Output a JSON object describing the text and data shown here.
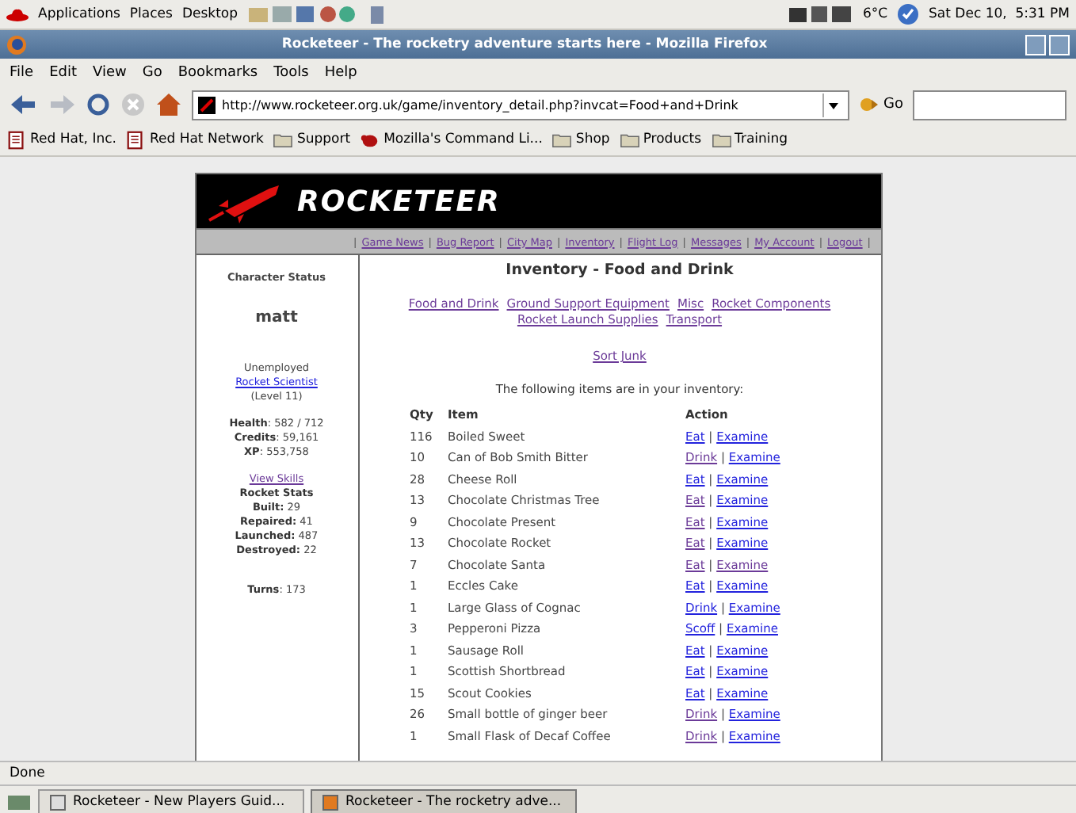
{
  "top_panel": {
    "menus": [
      "Applications",
      "Places",
      "Desktop"
    ],
    "temperature": "6°C",
    "clock": "Sat Dec 10,  5:31 PM"
  },
  "window": {
    "title": "Rocketeer - The rocketry adventure starts here - Mozilla Firefox"
  },
  "menu_bar": [
    "File",
    "Edit",
    "View",
    "Go",
    "Bookmarks",
    "Tools",
    "Help"
  ],
  "address_bar": {
    "url": "http://www.rocketeer.org.uk/game/inventory_detail.php?invcat=Food+and+Drink",
    "go": "Go"
  },
  "bookmarks": [
    {
      "kind": "page",
      "label": "Red Hat, Inc."
    },
    {
      "kind": "page",
      "label": "Red Hat Network"
    },
    {
      "kind": "folder",
      "label": "Support"
    },
    {
      "kind": "bug",
      "label": "Mozilla's Command Li..."
    },
    {
      "kind": "folder",
      "label": "Shop"
    },
    {
      "kind": "folder",
      "label": "Products"
    },
    {
      "kind": "folder",
      "label": "Training"
    }
  ],
  "site": {
    "logo": "ROCKETEER",
    "nav_separator": "|",
    "nav": [
      {
        "label": "Game News",
        "visited": true
      },
      {
        "label": "Bug Report",
        "visited": true
      },
      {
        "label": "City Map",
        "visited": true
      },
      {
        "label": "Inventory",
        "visited": true
      },
      {
        "label": "Flight Log",
        "visited": true
      },
      {
        "label": "Messages",
        "visited": true
      },
      {
        "label": "My Account",
        "visited": true
      },
      {
        "label": "Logout",
        "visited": true
      }
    ],
    "sidebar": {
      "heading": "Character Status",
      "name": "matt",
      "job": "Unemployed",
      "job_link": {
        "label": "Rocket Scientist",
        "visited": false
      },
      "level": "(Level 11)",
      "stats": [
        "**Health**: 582 / 712",
        "**Credits**: 59,161",
        "**XP**: 553,758"
      ],
      "skills_link": {
        "label": "View Skills",
        "visited": true
      },
      "rocket_stats_heading": "Rocket Stats",
      "rocket_stats": [
        "**Built:** 29",
        "**Repaired:** 41",
        "**Launched:** 487",
        "**Destroyed:** 22"
      ],
      "turns": "**Turns**: 173"
    },
    "main": {
      "heading": "Inventory - Food and Drink",
      "categories": [
        {
          "label": "Food and Drink",
          "visited": true
        },
        {
          "label": "Ground Support Equipment",
          "visited": true
        },
        {
          "label": "Misc",
          "visited": true
        },
        {
          "label": "Rocket Components",
          "visited": true
        },
        {
          "label": "Rocket Launch Supplies",
          "visited": true
        },
        {
          "label": "Transport",
          "visited": true
        }
      ],
      "sort_link": {
        "label": "Sort Junk",
        "visited": true
      },
      "intro": "The following items are in your inventory:",
      "columns": [
        "Qty",
        "Item",
        "Action"
      ],
      "action_separator": "|",
      "rows": [
        {
          "qty": "116",
          "item": "Boiled Sweet",
          "actions": [
            {
              "label": "Eat",
              "visited": false
            },
            {
              "label": "Examine",
              "visited": false
            }
          ]
        },
        {
          "qty": "10",
          "item": "Can of Bob Smith Bitter",
          "actions": [
            {
              "label": "Drink",
              "visited": true
            },
            {
              "label": "Examine",
              "visited": false
            }
          ]
        },
        {
          "qty": "28",
          "item": "Cheese Roll",
          "actions": [
            {
              "label": "Eat",
              "visited": false
            },
            {
              "label": "Examine",
              "visited": false
            }
          ]
        },
        {
          "qty": "13",
          "item": "Chocolate Christmas Tree",
          "actions": [
            {
              "label": "Eat",
              "visited": true
            },
            {
              "label": "Examine",
              "visited": false
            }
          ]
        },
        {
          "qty": "9",
          "item": "Chocolate Present",
          "actions": [
            {
              "label": "Eat",
              "visited": true
            },
            {
              "label": "Examine",
              "visited": false
            }
          ]
        },
        {
          "qty": "13",
          "item": "Chocolate Rocket",
          "actions": [
            {
              "label": "Eat",
              "visited": true
            },
            {
              "label": "Examine",
              "visited": false
            }
          ]
        },
        {
          "qty": "7",
          "item": "Chocolate Santa",
          "actions": [
            {
              "label": "Eat",
              "visited": true
            },
            {
              "label": "Examine",
              "visited": true
            }
          ]
        },
        {
          "qty": "1",
          "item": "Eccles Cake",
          "actions": [
            {
              "label": "Eat",
              "visited": false
            },
            {
              "label": "Examine",
              "visited": false
            }
          ]
        },
        {
          "qty": "1",
          "item": "Large Glass of Cognac",
          "actions": [
            {
              "label": "Drink",
              "visited": false
            },
            {
              "label": "Examine",
              "visited": false
            }
          ]
        },
        {
          "qty": "3",
          "item": "Pepperoni Pizza",
          "actions": [
            {
              "label": "Scoff",
              "visited": false
            },
            {
              "label": "Examine",
              "visited": false
            }
          ]
        },
        {
          "qty": "1",
          "item": "Sausage Roll",
          "actions": [
            {
              "label": "Eat",
              "visited": false
            },
            {
              "label": "Examine",
              "visited": false
            }
          ]
        },
        {
          "qty": "1",
          "item": "Scottish Shortbread",
          "actions": [
            {
              "label": "Eat",
              "visited": false
            },
            {
              "label": "Examine",
              "visited": false
            }
          ]
        },
        {
          "qty": "15",
          "item": "Scout Cookies",
          "actions": [
            {
              "label": "Eat",
              "visited": false
            },
            {
              "label": "Examine",
              "visited": false
            }
          ]
        },
        {
          "qty": "26",
          "item": "Small bottle of ginger beer",
          "actions": [
            {
              "label": "Drink",
              "visited": true
            },
            {
              "label": "Examine",
              "visited": false
            }
          ]
        },
        {
          "qty": "1",
          "item": "Small Flask of Decaf Coffee",
          "actions": [
            {
              "label": "Drink",
              "visited": true
            },
            {
              "label": "Examine",
              "visited": false
            }
          ]
        }
      ]
    }
  },
  "status_bar": "Done",
  "taskbar": [
    {
      "label": "Rocketeer - New Players Guid...",
      "selected": false
    },
    {
      "label": "Rocketeer - The rocketry adve...",
      "selected": true
    }
  ]
}
